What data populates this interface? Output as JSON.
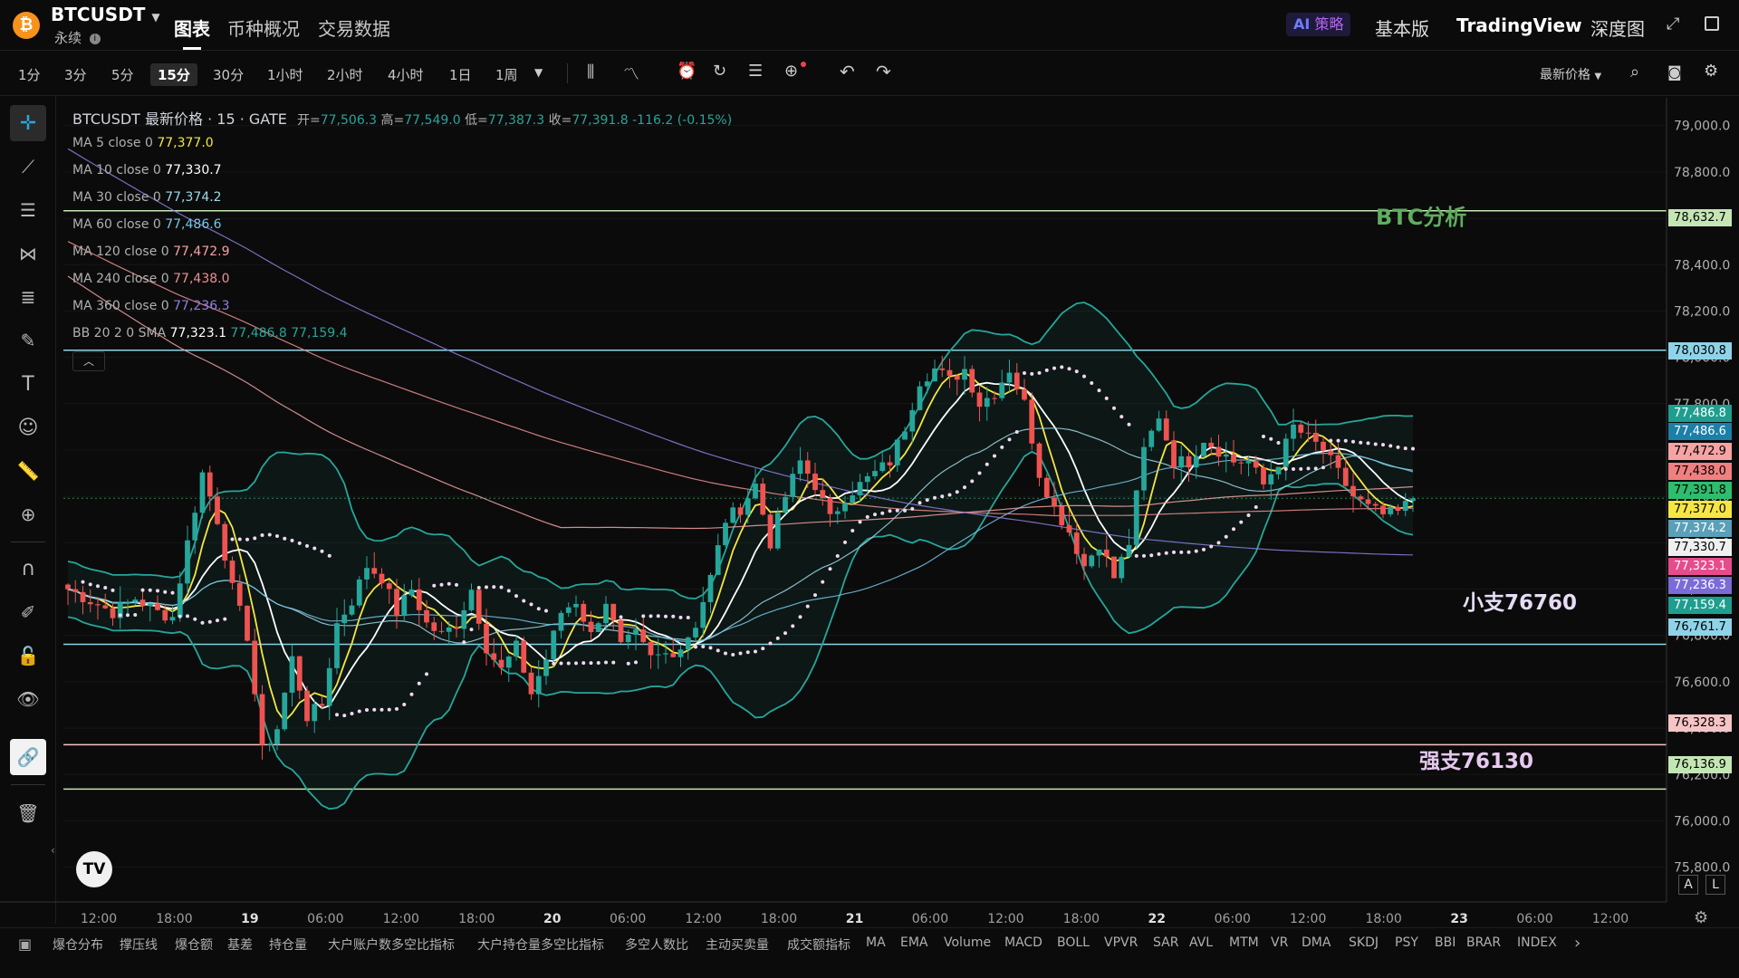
{
  "header": {
    "symbol": "BTCUSDT",
    "contract_type": "永续",
    "tabs": [
      "图表",
      "币种概况",
      "交易数据"
    ],
    "active_tab": "图表",
    "ai_badge": "策略",
    "ai_prefix": "AI",
    "right_links": [
      "基本版",
      "TradingView",
      "深度图"
    ]
  },
  "toolbar": {
    "timeframes": [
      "1分",
      "3分",
      "5分",
      "15分",
      "30分",
      "1小时",
      "2小时",
      "4小时",
      "1日",
      "1周"
    ],
    "active_timeframe": "15分",
    "price_mode": "最新价格"
  },
  "sidebar": {
    "tools": [
      "crosshair-icon",
      "trend-line-icon",
      "horizontal-lines-icon",
      "pattern-icon",
      "fib-icon",
      "brush-icon",
      "text-icon",
      "emoji-icon",
      "ruler-icon",
      "zoom-icon",
      "magnet-icon",
      "edit-lock-icon",
      "lock-icon",
      "eye-icon",
      "link-icon",
      "trash-icon"
    ],
    "active_tool": "link-icon"
  },
  "legend": {
    "title": "BTCUSDT 最新价格 · 15 · GATE",
    "ohlc": {
      "open_label": "开=",
      "open": "77,506.3",
      "high_label": "高=",
      "high": "77,549.0",
      "low_label": "低=",
      "low": "77,387.3",
      "close_label": "收=",
      "close": "77,391.8",
      "change": "-116.2 (-0.15%)"
    },
    "indicators": [
      {
        "label": "MA 5 close 0",
        "value": "77,377.0",
        "color": "#f5e642"
      },
      {
        "label": "MA 10 close 0",
        "value": "77,330.7",
        "color": "#ffffff"
      },
      {
        "label": "MA 30 close 0",
        "value": "77,374.2",
        "color": "#9fd8e8"
      },
      {
        "label": "MA 60 close 0",
        "value": "77,486.6",
        "color": "#74c7e6"
      },
      {
        "label": "MA 120 close 0",
        "value": "77,472.9",
        "color": "#f5a3a3"
      },
      {
        "label": "MA 240 close 0",
        "value": "77,438.0",
        "color": "#f08f8f"
      },
      {
        "label": "MA 360 close 0",
        "value": "77,236.3",
        "color": "#8f80e0"
      }
    ],
    "bb": {
      "label": "BB 20 2 0 SMA",
      "values": [
        "77,323.1",
        "77,486.8",
        "77,159.4"
      ],
      "colors": [
        "#ffffff",
        "#26a69a",
        "#26a69a"
      ]
    }
  },
  "annotations": [
    {
      "text": "BTC分析",
      "color": "#5fae5f"
    },
    {
      "text": "小支76760",
      "color": "#e6dcf5"
    },
    {
      "text": "强支76130",
      "color": "#e6c8f0"
    }
  ],
  "price_tags": [
    {
      "value": "78,632.7",
      "bg": "#c4e6b4",
      "fg": "#000000"
    },
    {
      "value": "78,030.8",
      "bg": "#8fd3e8",
      "fg": "#000000"
    },
    {
      "value": "77,486.8",
      "bg": "#1e9e8e",
      "fg": "#ffffff"
    },
    {
      "value": "77,486.6",
      "bg": "#1b7fa8",
      "fg": "#ffffff"
    },
    {
      "value": "77,472.9",
      "bg": "#f5a3a3",
      "fg": "#000000"
    },
    {
      "value": "77,438.0",
      "bg": "#f08080",
      "fg": "#000000"
    },
    {
      "value": "77,391.8",
      "bg": "#2ebd6e",
      "fg": "#000000"
    },
    {
      "value": "77,377.0",
      "bg": "#f5e642",
      "fg": "#000000"
    },
    {
      "value": "77,374.2",
      "bg": "#5aa0b8",
      "fg": "#ffffff"
    },
    {
      "value": "77,330.7",
      "bg": "#f0f0f0",
      "fg": "#000000"
    },
    {
      "value": "77,323.1",
      "bg": "#e64c8c",
      "fg": "#ffffff"
    },
    {
      "value": "77,236.3",
      "bg": "#7b6bd9",
      "fg": "#ffffff"
    },
    {
      "value": "77,159.4",
      "bg": "#1e9e8e",
      "fg": "#ffffff"
    },
    {
      "value": "76,761.7",
      "bg": "#8fd3e8",
      "fg": "#000000"
    },
    {
      "value": "76,328.3",
      "bg": "#f5c4c4",
      "fg": "#000000"
    },
    {
      "value": "76,136.9",
      "bg": "#c4e6b4",
      "fg": "#000000"
    }
  ],
  "chart_data": {
    "type": "candlestick",
    "symbol": "BTCUSDT",
    "interval": "15分",
    "y_ticks": [
      79000,
      78800,
      78600,
      78400,
      78200,
      78000,
      77800,
      77600,
      77400,
      77200,
      77000,
      76800,
      76600,
      76400,
      76200,
      76000,
      75800
    ],
    "y_tick_labels": [
      "79,000.0",
      "78,800.0",
      "78,600.0",
      "78,400.0",
      "78,200.0",
      "78,000.0",
      "77,800.0",
      "77,600.0",
      "77,400.0",
      "77,200.0",
      "77,000.0",
      "76,800.0",
      "76,600.0",
      "76,400.0",
      "76,200.0",
      "76,000.0",
      "75,800.0"
    ],
    "ylim": [
      75650,
      79120
    ],
    "x_tick_labels": [
      "12:00",
      "18:00",
      "19",
      "06:00",
      "12:00",
      "18:00",
      "20",
      "06:00",
      "12:00",
      "18:00",
      "21",
      "06:00",
      "12:00",
      "18:00",
      "22",
      "06:00",
      "12:00",
      "18:00",
      "23",
      "06:00",
      "12:00"
    ],
    "x_tick_bold": [
      false,
      false,
      true,
      false,
      false,
      false,
      true,
      false,
      false,
      false,
      true,
      false,
      false,
      false,
      true,
      false,
      false,
      false,
      true,
      false,
      false
    ],
    "horizontal_levels": [
      {
        "price": 78632.7,
        "color": "#c4e6b4"
      },
      {
        "price": 78030.8,
        "color": "#8fd3e8"
      },
      {
        "price": 76761.7,
        "color": "#8fd3e8"
      },
      {
        "price": 76328.3,
        "color": "#f5c4c4"
      },
      {
        "price": 76136.9,
        "color": "#c4e6b4"
      }
    ],
    "close_path": [
      [
        0,
        77000
      ],
      [
        3,
        76950
      ],
      [
        6,
        76900
      ],
      [
        9,
        76960
      ],
      [
        12,
        76900
      ],
      [
        14,
        76880
      ],
      [
        16,
        77200
      ],
      [
        18,
        77500
      ],
      [
        20,
        77300
      ],
      [
        22,
        77000
      ],
      [
        24,
        76800
      ],
      [
        26,
        76300
      ],
      [
        28,
        76400
      ],
      [
        30,
        76700
      ],
      [
        32,
        76450
      ],
      [
        34,
        76500
      ],
      [
        36,
        76850
      ],
      [
        38,
        76950
      ],
      [
        40,
        77100
      ],
      [
        42,
        77050
      ],
      [
        44,
        76900
      ],
      [
        46,
        77000
      ],
      [
        48,
        76850
      ],
      [
        50,
        76800
      ],
      [
        52,
        76850
      ],
      [
        54,
        77000
      ],
      [
        56,
        76750
      ],
      [
        58,
        76650
      ],
      [
        60,
        76750
      ],
      [
        62,
        76550
      ],
      [
        64,
        76700
      ],
      [
        66,
        76900
      ],
      [
        68,
        76950
      ],
      [
        70,
        76800
      ],
      [
        72,
        76950
      ],
      [
        74,
        76750
      ],
      [
        76,
        76800
      ],
      [
        78,
        76700
      ],
      [
        80,
        76720
      ],
      [
        82,
        76750
      ],
      [
        84,
        76850
      ],
      [
        86,
        77050
      ],
      [
        88,
        77300
      ],
      [
        90,
        77350
      ],
      [
        92,
        77450
      ],
      [
        94,
        77200
      ],
      [
        96,
        77400
      ],
      [
        98,
        77550
      ],
      [
        100,
        77450
      ],
      [
        102,
        77300
      ],
      [
        104,
        77400
      ],
      [
        106,
        77450
      ],
      [
        108,
        77500
      ],
      [
        110,
        77550
      ],
      [
        112,
        77700
      ],
      [
        114,
        77900
      ],
      [
        116,
        77950
      ],
      [
        118,
        77900
      ],
      [
        120,
        77950
      ],
      [
        122,
        77800
      ],
      [
        124,
        77850
      ],
      [
        126,
        77950
      ],
      [
        128,
        77800
      ],
      [
        130,
        77500
      ],
      [
        132,
        77350
      ],
      [
        134,
        77250
      ],
      [
        136,
        77100
      ],
      [
        138,
        77200
      ],
      [
        140,
        77050
      ],
      [
        142,
        77200
      ],
      [
        144,
        77600
      ],
      [
        146,
        77750
      ],
      [
        148,
        77550
      ],
      [
        150,
        77550
      ],
      [
        152,
        77650
      ],
      [
        154,
        77600
      ],
      [
        156,
        77550
      ],
      [
        158,
        77550
      ],
      [
        160,
        77450
      ],
      [
        162,
        77550
      ],
      [
        164,
        77700
      ],
      [
        166,
        77650
      ],
      [
        168,
        77600
      ],
      [
        170,
        77500
      ],
      [
        172,
        77400
      ],
      [
        174,
        77350
      ],
      [
        176,
        77320
      ],
      [
        178,
        77330
      ],
      [
        180,
        77391.8
      ]
    ]
  },
  "indicator_bar": {
    "items": [
      "爆仓分布",
      "撑压线",
      "爆仓额",
      "基差",
      "持仓量",
      "大户账户数多空比指标",
      "大户持仓量多空比指标",
      "多空人数比",
      "主动买卖量",
      "成交额指标",
      "MA",
      "EMA",
      "Volume",
      "MACD",
      "BOLL",
      "VPVR",
      "SAR",
      "AVL",
      "MTM",
      "VR",
      "DMA",
      "SKDJ",
      "PSY",
      "BBI",
      "BRAR",
      "INDEX"
    ]
  },
  "scale_buttons": [
    "A",
    "L"
  ]
}
